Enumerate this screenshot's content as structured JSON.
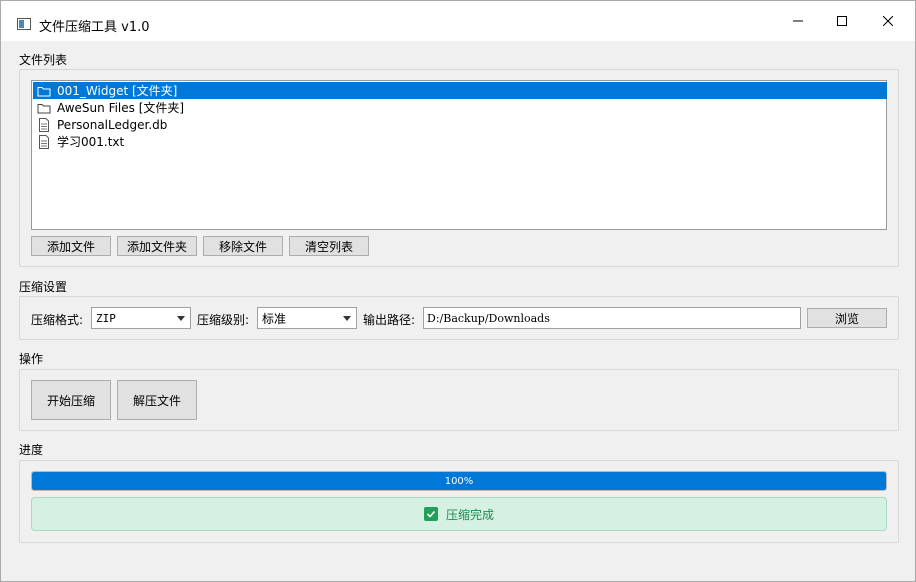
{
  "window": {
    "title": "文件压缩工具 v1.0"
  },
  "file_list": {
    "group_label": "文件列表",
    "items": [
      {
        "name": "001_Widget [文件夹]",
        "icon": "folder-icon",
        "selected": true
      },
      {
        "name": "AweSun Files [文件夹]",
        "icon": "folder-icon",
        "selected": false
      },
      {
        "name": "PersonalLedger.db",
        "icon": "file-icon",
        "selected": false
      },
      {
        "name": "学习001.txt",
        "icon": "file-icon",
        "selected": false
      }
    ],
    "buttons": {
      "add_file": "添加文件",
      "add_folder": "添加文件夹",
      "remove_file": "移除文件",
      "clear_list": "清空列表"
    }
  },
  "settings": {
    "group_label": "压缩设置",
    "format_label": "压缩格式:",
    "format_value": "ZIP",
    "level_label": "压缩级别:",
    "level_value": "标准",
    "output_label": "输出路径:",
    "output_value": "D:/Backup/Downloads",
    "browse_label": "浏览"
  },
  "actions": {
    "group_label": "操作",
    "compress_label": "开始压缩",
    "extract_label": "解压文件"
  },
  "progress": {
    "group_label": "进度",
    "percent": 100,
    "percent_text": "100%",
    "status_text": "压缩完成",
    "status_icon": "check-icon"
  },
  "colors": {
    "accent": "#0078d7",
    "success_bg": "#d4f1e3",
    "success_text": "#1e8a4d"
  }
}
